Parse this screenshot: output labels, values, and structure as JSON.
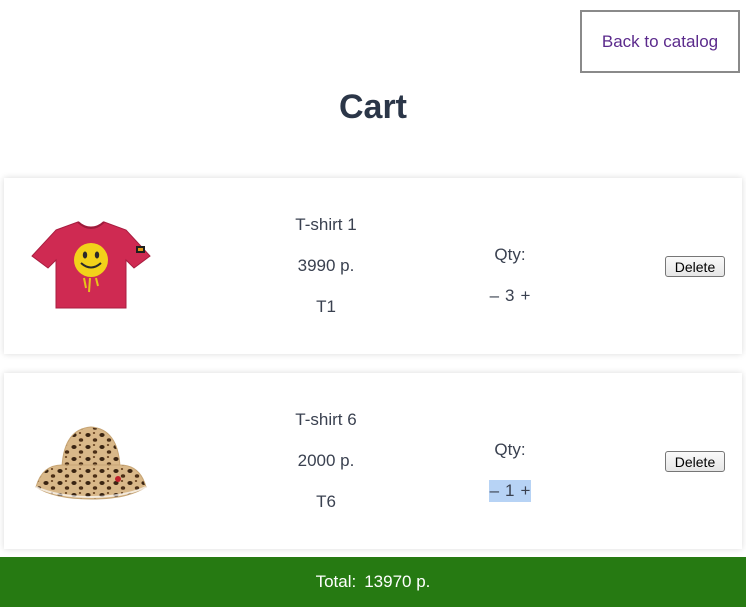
{
  "header": {
    "back_label": "Back to catalog",
    "title": "Cart"
  },
  "cart": {
    "items": [
      {
        "name": "T-shirt 1",
        "price": "3990 р.",
        "code": "T1",
        "qty_label": "Qty:",
        "qty_minus": "–",
        "qty": "3",
        "qty_plus": "+",
        "delete_label": "Delete",
        "image": "red-tshirt-smiley-image"
      },
      {
        "name": "T-shirt 6",
        "price": "2000 р.",
        "code": "T6",
        "qty_label": "Qty:",
        "qty_minus": "–",
        "qty": "1",
        "qty_plus": "+",
        "delete_label": "Delete",
        "image": "leopard-bucket-hat-image"
      }
    ]
  },
  "footer": {
    "total_label": "Total:",
    "total_value": "13970 р."
  },
  "colors": {
    "total_bar": "#267a12",
    "back_link": "#5b2a8c",
    "title": "#2b3648",
    "selection": "#b7d3f5"
  }
}
